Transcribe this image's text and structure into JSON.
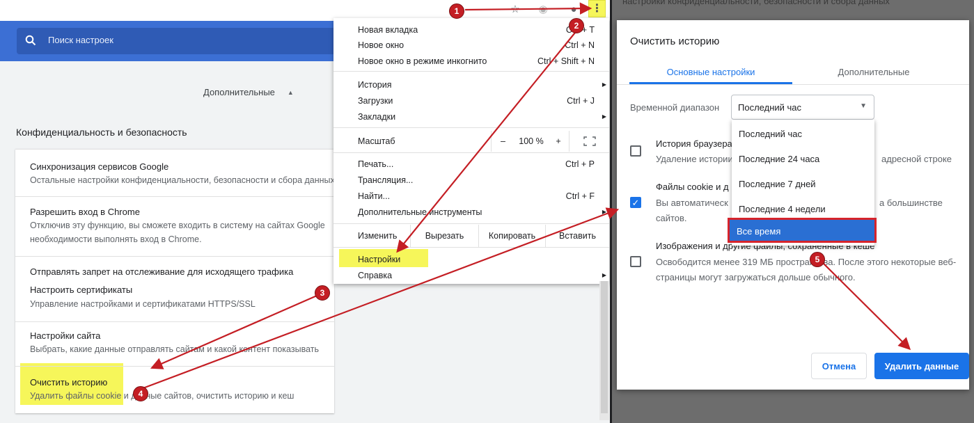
{
  "settings": {
    "search_placeholder": "Поиск настроек",
    "advanced_label": "Дополнительные",
    "privacy_heading": "Конфиденциальность и безопасность",
    "rows": [
      {
        "title": "Синхронизация сервисов Google",
        "subtitle": "Остальные настройки конфиденциальности, безопасности и сбора данных"
      },
      {
        "title": "Разрешить вход в Chrome",
        "subtitle": "Отключив эту функцию, вы сможете входить в систему на сайтах Google",
        "subtitle2": "необходимости выполнять вход в Chrome."
      },
      {
        "title": "Отправлять запрет на отслеживание для исходящего трафика"
      },
      {
        "title": "Настроить сертификаты",
        "subtitle": "Управление настройками и сертификатами HTTPS/SSL"
      },
      {
        "title": "Настройки сайта",
        "subtitle": "Выбрать, какие данные отправлять сайтам и какой контент показывать"
      },
      {
        "title": "Очистить историю",
        "subtitle": "Удалить файлы cookie и данные сайтов, очистить историю и кеш"
      }
    ]
  },
  "menu": {
    "new_tab": {
      "label": "Новая вкладка",
      "shortcut": "Ctrl + T"
    },
    "new_window": {
      "label": "Новое окно",
      "shortcut": "Ctrl + N"
    },
    "incognito": {
      "label": "Новое окно в режиме инкогнито",
      "shortcut": "Ctrl + Shift + N"
    },
    "history": {
      "label": "История"
    },
    "downloads": {
      "label": "Загрузки",
      "shortcut": "Ctrl + J"
    },
    "bookmarks": {
      "label": "Закладки"
    },
    "zoom": {
      "label": "Масштаб",
      "minus": "–",
      "value": "100 %",
      "plus": "+"
    },
    "print": {
      "label": "Печать...",
      "shortcut": "Ctrl + P"
    },
    "cast": {
      "label": "Трансляция..."
    },
    "find": {
      "label": "Найти...",
      "shortcut": "Ctrl + F"
    },
    "more_tools": {
      "label": "Дополнительные инструменты"
    },
    "edit": {
      "label": "Изменить",
      "cut": "Вырезать",
      "copy": "Копировать",
      "paste": "Вставить"
    },
    "settings": {
      "label": "Настройки"
    },
    "help": {
      "label": "Справка"
    }
  },
  "dialog": {
    "background_text": "настройки конфиденциальности, безопасности и сбора данных",
    "title": "Очистить историю",
    "tab_basic": "Основные настройки",
    "tab_advanced": "Дополнительные",
    "range_label": "Временной диапазон",
    "range_value": "Последний час",
    "range_options": [
      "Последний час",
      "Последние 24 часа",
      "Последние 7 дней",
      "Последние 4 недели",
      "Все время"
    ],
    "items": [
      {
        "title": "История браузера",
        "subtitle": "Удаление истории",
        "subtitle_tail": "адресной строке",
        "checked": false
      },
      {
        "title": "Файлы cookie и д",
        "subtitle": "Вы автоматическ",
        "subtitle_tail": "а большинстве",
        "subtitle2": "сайтов.",
        "checked": true
      },
      {
        "title": "Изображения и другие файлы, сохраненные в кеше",
        "subtitle": "Освободится менее 319 МБ пространства. После этого некоторые веб-",
        "subtitle2": "страницы могут загружаться дольше обычного.",
        "checked": false
      }
    ],
    "cancel_label": "Отмена",
    "delete_label": "Удалить данные"
  },
  "annotations": {
    "steps": [
      "1",
      "2",
      "3",
      "4",
      "5"
    ],
    "color": "#c41e24",
    "highlight": "#f6f65a"
  }
}
